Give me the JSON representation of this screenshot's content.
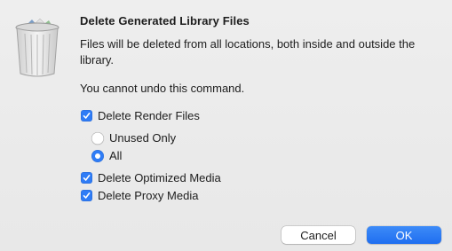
{
  "dialog": {
    "title": "Delete Generated Library Files",
    "message": "Files will be deleted from all locations, both inside and outside the library.",
    "warning": "You cannot undo this command."
  },
  "options": {
    "render_files": {
      "label": "Delete Render Files",
      "checked": true
    },
    "render_choices": [
      {
        "label": "Unused Only",
        "selected": false
      },
      {
        "label": "All",
        "selected": true
      }
    ],
    "optimized_media": {
      "label": "Delete Optimized Media",
      "checked": true
    },
    "proxy_media": {
      "label": "Delete Proxy Media",
      "checked": true
    }
  },
  "buttons": {
    "cancel": "Cancel",
    "ok": "OK"
  },
  "colors": {
    "accent": "#2f7cf6",
    "background": "#ececec"
  },
  "icons": {
    "dialog_icon": "trash-icon",
    "check": "checkmark-icon"
  }
}
